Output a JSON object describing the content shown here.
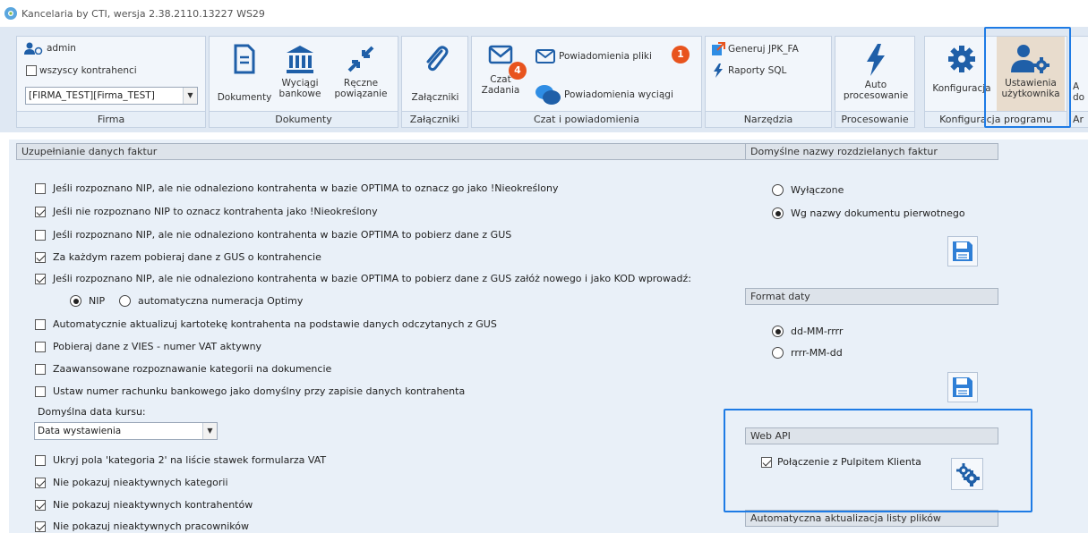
{
  "window": {
    "title": "Kancelaria by CTI, wersja  2.38.2110.13227 WS29"
  },
  "ribbon": {
    "firma": {
      "caption": "Firma",
      "user": "admin",
      "all_contractors": "wszyscy kontrahenci",
      "company_select": "[FIRMA_TEST][Firma_TEST]"
    },
    "dokumenty": {
      "caption": "Dokumenty",
      "dokumenty_label": "Dokumenty",
      "wyciagi_l1": "Wyciągi",
      "wyciagi_l2": "bankowe",
      "reczne_l1": "Ręczne",
      "reczne_l2": "powiązanie"
    },
    "zalaczniki": {
      "caption": "Załączniki",
      "label": "Załączniki"
    },
    "czat": {
      "caption": "Czat i powiadomienia",
      "czat_l1": "Czat",
      "czat_l2": "Zadania",
      "czat_badge": "4",
      "pow_pliki": "Powiadomienia pliki",
      "pow_pliki_badge": "1",
      "pow_wyciagi": "Powiadomienia wyciągi"
    },
    "narzedzia": {
      "caption": "Narzędzia",
      "jpk": "Generuj JPK_FA",
      "raporty": "Raporty SQL"
    },
    "procesowanie": {
      "caption": "Procesowanie",
      "auto_l1": "Auto",
      "auto_l2": "procesowanie"
    },
    "konfiguracja": {
      "caption": "Konfiguracja programu",
      "konfiguracja_label": "Konfiguracja",
      "ustawienia_l1": "Ustawienia",
      "ustawienia_l2": "użytkownika",
      "cut_l1": "A",
      "cut_l2": "do",
      "cut_caption": "Ar"
    }
  },
  "main": {
    "invoice_panel": {
      "header": "Uzupełnianie danych faktur",
      "options": [
        {
          "label": "Jeśli rozpoznano NIP, ale nie odnaleziono kontrahenta w bazie OPTIMA to oznacz go jako !Nieokreślony",
          "checked": false
        },
        {
          "label": "Jeśli nie rozpoznano NIP to oznacz kontrahenta jako !Nieokreślony",
          "checked": true
        },
        {
          "label": "Jeśli rozpoznano NIP, ale nie odnaleziono kontrahenta w bazie OPTIMA to pobierz dane z GUS",
          "checked": false
        },
        {
          "label": "Za każdym razem pobieraj dane z GUS o kontrahencie",
          "checked": true
        },
        {
          "label": "Jeśli rozpoznano NIP, ale nie odnaleziono kontrahenta w bazie OPTIMA to pobierz dane z GUS załóż nowego i jako KOD wprowadź:",
          "checked": true
        }
      ],
      "kod_nip": "NIP",
      "kod_auto": "automatyczna numeracja Optimy",
      "options2": [
        {
          "label": "Automatycznie aktualizuj kartotekę kontrahenta na podstawie danych odczytanych z GUS",
          "checked": false
        },
        {
          "label": "Pobieraj dane z VIES - numer VAT aktywny",
          "checked": false
        },
        {
          "label": "Zaawansowane rozpoznawanie kategorii na dokumencie",
          "checked": false
        },
        {
          "label": "Ustaw numer rachunku bankowego jako domyślny przy zapisie danych kontrahenta",
          "checked": false
        }
      ],
      "date_label": "Domyślna data kursu:",
      "date_value": "Data wystawienia",
      "options3": [
        {
          "label": "Ukryj pola 'kategoria 2' na liście stawek formularza VAT",
          "checked": false
        },
        {
          "label": "Nie pokazuj nieaktywnych kategorii",
          "checked": true
        },
        {
          "label": "Nie pokazuj nieaktywnych kontrahentów",
          "checked": true
        },
        {
          "label": "Nie pokazuj nieaktywnych pracowników",
          "checked": true
        }
      ]
    },
    "names_panel": {
      "header": "Domyślne nazwy rozdzielanych faktur",
      "opt_off": "Wyłączone",
      "opt_by_name": "Wg nazwy dokumentu pierwotnego"
    },
    "date_panel": {
      "header": "Format daty",
      "opt1": "dd-MM-rrrr",
      "opt2": "rrrr-MM-dd"
    },
    "webapi_panel": {
      "header": "Web API",
      "connection": "Połączenie z Pulpitem Klienta"
    },
    "files_panel": {
      "header": "Automatyczna aktualizacja listy plików"
    }
  },
  "colors": {
    "accent": "#1e7be5",
    "ribbon_icon": "#1f5fa8",
    "badge": "#e8541e"
  }
}
